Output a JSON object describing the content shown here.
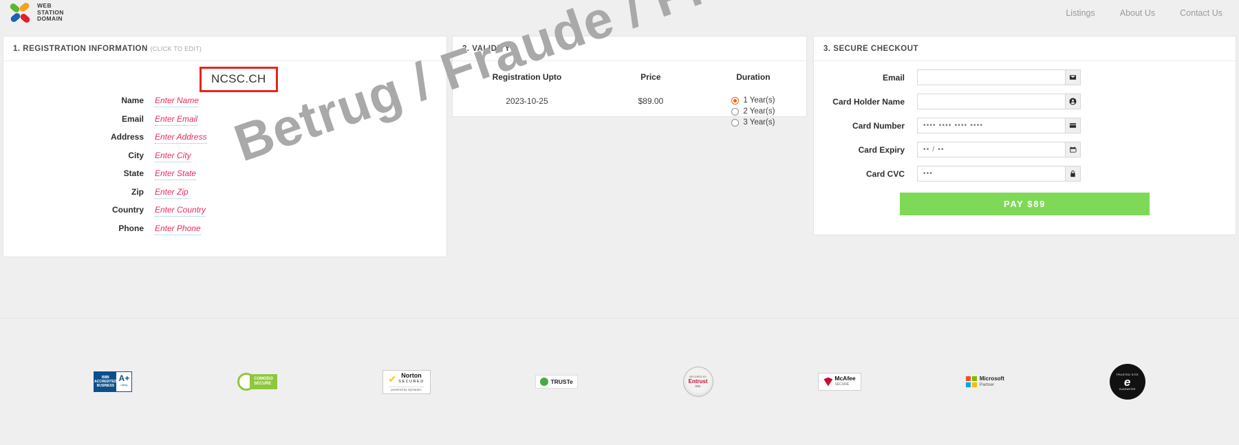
{
  "header": {
    "logo_lines": [
      "WEB",
      "STATION",
      "DOMAIN"
    ],
    "nav": [
      {
        "label": "Listings"
      },
      {
        "label": "About Us"
      },
      {
        "label": "Contact Us"
      }
    ]
  },
  "registration": {
    "title": "1. REGISTRATION INFORMATION",
    "title_hint": "(CLICK TO EDIT)",
    "domain": "NCSC.CH",
    "fields": [
      {
        "label": "Name",
        "value": "Enter Name"
      },
      {
        "label": "Email",
        "value": "Enter Email"
      },
      {
        "label": "Address",
        "value": "Enter Address"
      },
      {
        "label": "City",
        "value": "Enter City"
      },
      {
        "label": "State",
        "value": "Enter State"
      },
      {
        "label": "Zip",
        "value": "Enter Zip"
      },
      {
        "label": "Country",
        "value": "Enter Country"
      },
      {
        "label": "Phone",
        "value": "Enter Phone"
      }
    ]
  },
  "validity": {
    "title": "2. VALIDITY",
    "columns": [
      "Registration Upto",
      "Price",
      "Duration"
    ],
    "registration_upto": "2023-10-25",
    "price": "$89.00",
    "durations": [
      {
        "label": "1 Year(s)",
        "selected": true
      },
      {
        "label": "2 Year(s)",
        "selected": false
      },
      {
        "label": "3 Year(s)",
        "selected": false
      }
    ],
    "selected_radio_color": "#f4600c"
  },
  "checkout": {
    "title": "3. SECURE CHECKOUT",
    "fields": [
      {
        "label": "Email",
        "value": "",
        "placeholder": "",
        "icon": "envelope-icon"
      },
      {
        "label": "Card Holder Name",
        "value": "",
        "placeholder": "",
        "icon": "user-icon"
      },
      {
        "label": "Card Number",
        "value": "",
        "placeholder": "•••• •••• •••• ••••",
        "icon": "credit-card-icon"
      },
      {
        "label": "Card Expiry",
        "value": "",
        "placeholder": "•• / ••",
        "icon": "calendar-icon"
      },
      {
        "label": "Card CVC",
        "value": "",
        "placeholder": "•••",
        "icon": "lock-icon"
      }
    ],
    "pay_button": "PAY $89",
    "pay_button_color": "#7ed957"
  },
  "watermark": {
    "text": "Betrug / Fraude / Frode / Fraud",
    "color": "#a9a9a9"
  },
  "footer": {
    "badges": [
      {
        "name": "bbb-accredited-business-badge",
        "line1": "BBB",
        "line2": "ACCREDITED",
        "line3": "BUSINESS",
        "grade": "A+",
        "caption": "rating"
      },
      {
        "name": "comodo-secure-badge",
        "line1": "COMODO",
        "line2": "SECURE"
      },
      {
        "name": "norton-secured-badge",
        "line1": "Norton",
        "line2": "SECURED",
        "line3": "powered by Symantec"
      },
      {
        "name": "truste-certified-badge",
        "line1": "TRUSTe"
      },
      {
        "name": "entrust-ssl-badge",
        "line1": "SECURED BY",
        "line2": "Entrust",
        "line3": "SSL"
      },
      {
        "name": "mcafee-secure-badge",
        "line1": "McAfee",
        "line2": "SECURE"
      },
      {
        "name": "microsoft-partner-badge",
        "line1": "Microsoft",
        "line2": "Partner"
      },
      {
        "name": "trusted-site-guarantee-seal",
        "line1": "TRUSTED SITE",
        "line2": "e",
        "line3": "GUARANTEE"
      }
    ]
  }
}
